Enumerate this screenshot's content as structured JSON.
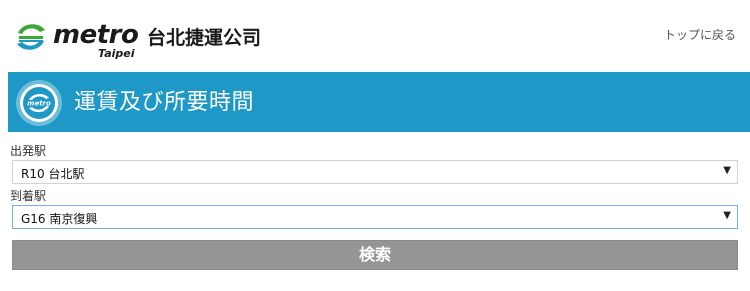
{
  "header": {
    "logo_word": "metro",
    "logo_sub": "Taipei",
    "logo_company": "台北捷運公司",
    "top_link": "トップに戻る"
  },
  "banner": {
    "title": "運賃及び所要時間",
    "badge_word": "metro",
    "badge_sub": "Taipei",
    "color": "#1e98c6"
  },
  "form": {
    "departure_label": "出発駅",
    "departure_value": "R10 台北駅",
    "arrival_label": "到着駅",
    "arrival_value": "G16 南京復興",
    "search_label": "検索"
  },
  "icons": {
    "logo": "metro-logo-icon",
    "badge": "metro-badge-icon",
    "dropdown": "chevron-down-icon"
  },
  "colors": {
    "brand_green": "#3aa935",
    "brand_blue": "#1e98c6",
    "button_gray": "#959595"
  }
}
